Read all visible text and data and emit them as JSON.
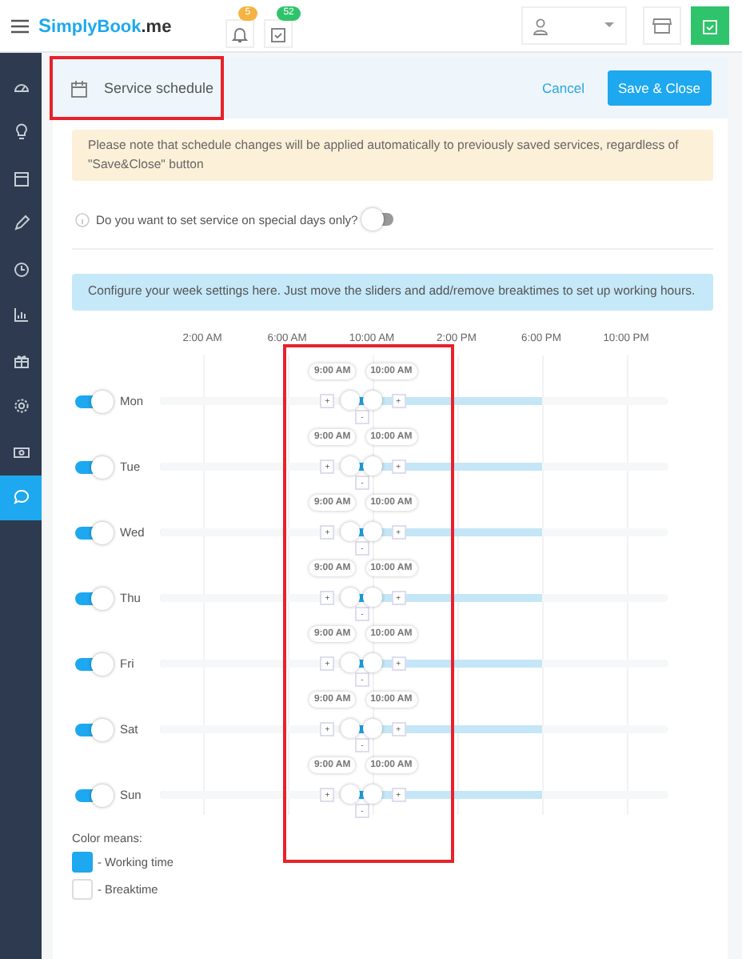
{
  "topbar": {
    "logo_initial": "S",
    "logo_rest": "implyBook",
    "logo_suffix": ".me",
    "notifications": {
      "badge": "5"
    },
    "bookings": {
      "badge": "52"
    }
  },
  "sidebar": {
    "items": [
      {
        "selected": false
      },
      {
        "selected": false
      },
      {
        "selected": false
      },
      {
        "selected": false
      },
      {
        "selected": false
      },
      {
        "selected": false
      },
      {
        "selected": false
      },
      {
        "selected": false
      },
      {
        "selected": false
      },
      {
        "selected": true
      }
    ]
  },
  "header": {
    "title": "Service schedule",
    "cancel": "Cancel",
    "save": "Save & Close"
  },
  "warning": "Please note that schedule changes will be applied automatically to previously saved services, regardless of \"Save&Close\" button",
  "special_days": {
    "label": "Do you want to set service on special days only?",
    "on": false
  },
  "info": "Configure your week settings here. Just move the sliders and add/remove breaktimes to set up working hours.",
  "schedule": {
    "times": [
      "2:00 AM",
      "6:00 AM",
      "10:00 AM",
      "2:00 PM",
      "6:00 PM",
      "10:00 PM"
    ],
    "days": [
      {
        "name": "Mon",
        "on": true,
        "handles": [
          {
            "label": "9:00 AM",
            "level": 0.375
          },
          {
            "label": "10:00 AM",
            "level": 0.417
          }
        ],
        "working": {
          "level": 0.75
        },
        "add": [
          "+",
          "+"
        ],
        "remove": "-"
      },
      {
        "name": "Tue",
        "on": true,
        "handles": [
          {
            "label": "9:00 AM",
            "level": 0.375
          },
          {
            "label": "10:00 AM",
            "level": 0.417
          }
        ],
        "working": {
          "level": 0.75
        },
        "add": [
          "+",
          "+"
        ],
        "remove": "-"
      },
      {
        "name": "Wed",
        "on": true,
        "handles": [
          {
            "label": "9:00 AM",
            "level": 0.375
          },
          {
            "label": "10:00 AM",
            "level": 0.417
          }
        ],
        "working": {
          "level": 0.75
        },
        "add": [
          "+",
          "+"
        ],
        "remove": "-"
      },
      {
        "name": "Thu",
        "on": true,
        "handles": [
          {
            "label": "9:00 AM",
            "level": 0.375
          },
          {
            "label": "10:00 AM",
            "level": 0.417
          }
        ],
        "working": {
          "level": 0.75
        },
        "add": [
          "+",
          "+"
        ],
        "remove": "-"
      },
      {
        "name": "Fri",
        "on": true,
        "handles": [
          {
            "label": "9:00 AM",
            "level": 0.375
          },
          {
            "label": "10:00 AM",
            "level": 0.417
          }
        ],
        "working": {
          "level": 0.75
        },
        "add": [
          "+",
          "+"
        ],
        "remove": "-"
      },
      {
        "name": "Sat",
        "on": true,
        "handles": [
          {
            "label": "9:00 AM",
            "level": 0.375
          },
          {
            "label": "10:00 AM",
            "level": 0.417
          }
        ],
        "working": {
          "level": 0.75
        },
        "add": [
          "+",
          "+"
        ],
        "remove": "-"
      },
      {
        "name": "Sun",
        "on": true,
        "handles": [
          {
            "label": "9:00 AM",
            "level": 0.375
          },
          {
            "label": "10:00 AM",
            "level": 0.417
          }
        ],
        "working": {
          "level": 0.75
        },
        "add": [
          "+",
          "+"
        ],
        "remove": "-"
      }
    ]
  },
  "legend": {
    "title": "Color means:",
    "items": [
      {
        "label": "- Working time",
        "kind": "working"
      },
      {
        "label": "- Breaktime",
        "kind": "break"
      }
    ]
  }
}
